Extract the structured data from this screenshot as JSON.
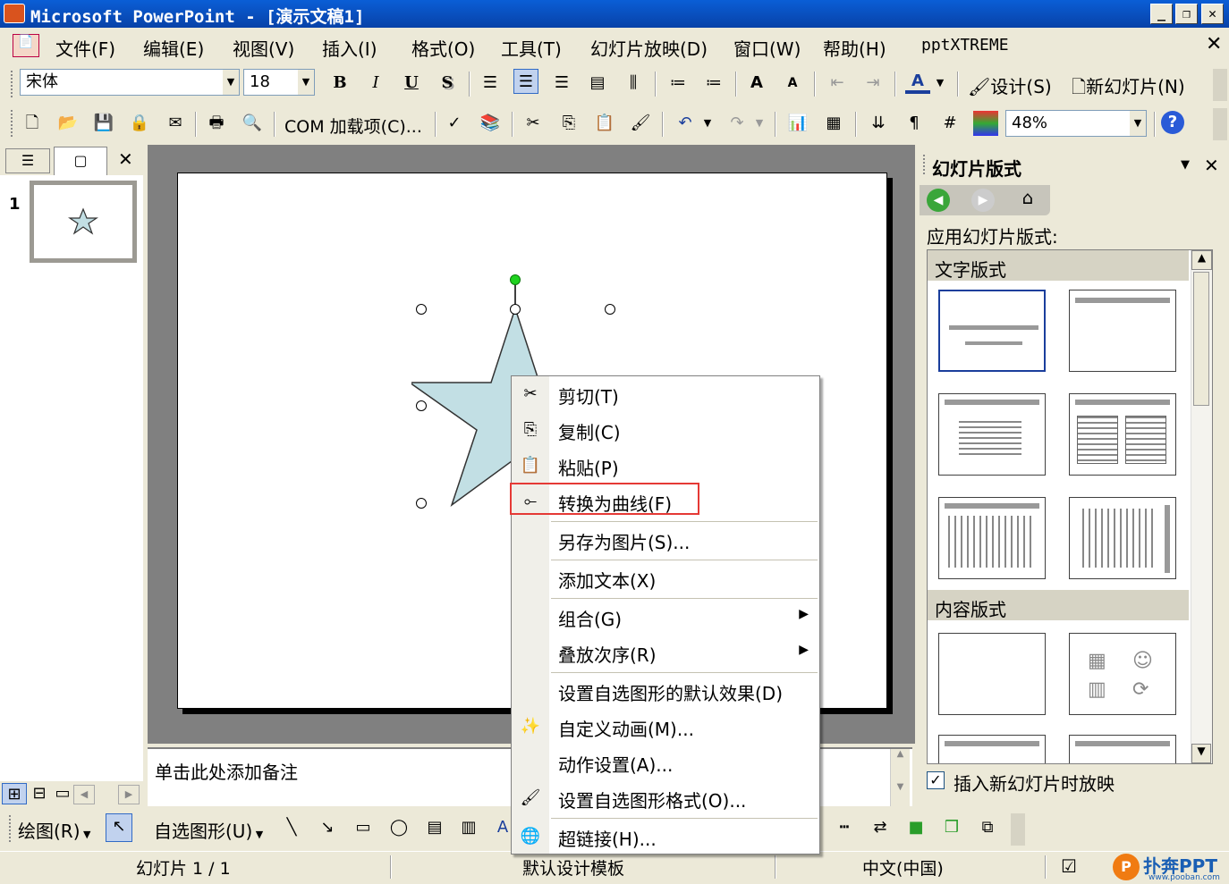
{
  "window": {
    "title": "Microsoft PowerPoint - [演示文稿1]"
  },
  "menu": {
    "items": [
      "文件(F)",
      "编辑(E)",
      "视图(V)",
      "插入(I)",
      "格式(O)",
      "工具(T)",
      "幻灯片放映(D)",
      "窗口(W)",
      "帮助(H)",
      "pptXTREME"
    ]
  },
  "format_toolbar": {
    "font": "宋体",
    "size": "18",
    "bold": "B",
    "italic": "I",
    "underline": "U",
    "shadow": "S",
    "design": "设计(S)",
    "new_slide": "新幻灯片(N)"
  },
  "std_toolbar": {
    "com_addins": "COM 加载项(C)...",
    "zoom": "48%"
  },
  "slide_panel": {
    "slide_number": "1"
  },
  "notes": {
    "placeholder": "单击此处添加备注"
  },
  "context_menu": {
    "items": [
      "剪切(T)",
      "复制(C)",
      "粘贴(P)",
      "转换为曲线(F)",
      "另存为图片(S)...",
      "添加文本(X)",
      "组合(G)",
      "叠放次序(R)",
      "设置自选图形的默认效果(D)",
      "自定义动画(M)...",
      "动作设置(A)...",
      "设置自选图形格式(O)...",
      "超链接(H)..."
    ]
  },
  "task_pane": {
    "title": "幻灯片版式",
    "apply_label": "应用幻灯片版式:",
    "section_text": "文字版式",
    "section_content": "内容版式",
    "checkbox_label": "插入新幻灯片时放映"
  },
  "drawing_toolbar": {
    "draw": "绘图(R)",
    "autoshapes": "自选图形(U)"
  },
  "status": {
    "slide": "幻灯片 1 / 1",
    "template": "默认设计模板",
    "language": "中文(中国)"
  },
  "watermark": {
    "brand": "扑奔PPT",
    "url": "www.pooban.com"
  }
}
